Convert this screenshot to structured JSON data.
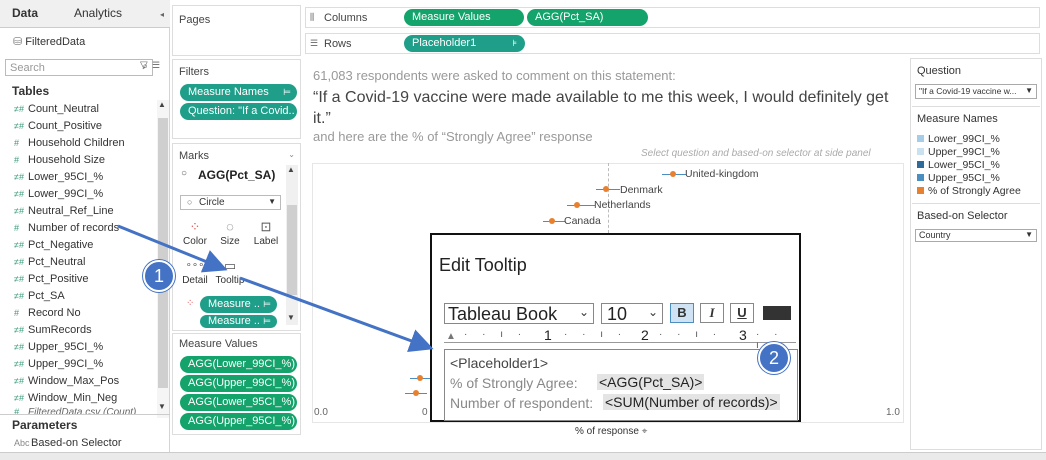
{
  "data_pane": {
    "tabs": [
      "Data",
      "Analytics"
    ],
    "datasource": "FilteredData",
    "search_placeholder": "Search",
    "tables_heading": "Tables",
    "fields": [
      "Count_Neutral",
      "Count_Positive",
      "Household Children",
      "Household Size",
      "Lower_95CI_%",
      "Lower_99CI_%",
      "Neutral_Ref_Line",
      "Number of records",
      "Pct_Negative",
      "Pct_Neutral",
      "Pct_Positive",
      "Pct_SA",
      "Record No",
      "SumRecords",
      "Upper_95CI_%",
      "Upper_99CI_%",
      "Window_Max_Pos",
      "Window_Min_Neg",
      "FilteredData.csv (Count)"
    ],
    "parameters_heading": "Parameters",
    "parameters": [
      "Based-on Selector"
    ]
  },
  "pages": {
    "label": "Pages"
  },
  "filters": {
    "label": "Filters",
    "pills": [
      "Measure Names",
      "Question: \"If a Covid.."
    ]
  },
  "marks": {
    "label": "Marks",
    "card_title": "AGG(Pct_SA)",
    "mark_type": "Circle",
    "buttons": [
      "Color",
      "Size",
      "Label",
      "Detail",
      "Tooltip"
    ],
    "pills": [
      "Measure ..",
      "Measure .."
    ]
  },
  "measure_values": {
    "label": "Measure Values",
    "pills": [
      "AGG(Lower_99CI_%)",
      "AGG(Upper_99CI_%)",
      "AGG(Lower_95CI_%)",
      "AGG(Upper_95CI_%)"
    ]
  },
  "shelves": {
    "columns_label": "Columns",
    "columns": [
      "Measure Values",
      "AGG(Pct_SA)"
    ],
    "rows_label": "Rows",
    "rows": [
      "Placeholder1"
    ]
  },
  "view": {
    "subtitle": "61,083 respondents were asked to comment on this statement:",
    "quote": "“If a Covid-19 vaccine were made available to me this week, I would definitely get it.”",
    "note": "and here are the % of “Strongly Agree” response",
    "hint": "Select question and based-on selector at side panel",
    "countries": [
      "United-kingdom",
      "Denmark",
      "Netherlands",
      "Canada"
    ],
    "axis_min": "0.0",
    "axis_zero": "0",
    "axis_max": "1.0",
    "axis_title": "% of response"
  },
  "tooltip_dialog": {
    "title": "Edit Tooltip",
    "font": "Tableau Book",
    "size": "10",
    "bold": "B",
    "italic": "I",
    "underline": "U",
    "ruler": [
      "1",
      "2",
      "3"
    ],
    "line1": "<Placeholder1>",
    "line2_label": "% of Strongly Agree:",
    "line2_value": "<AGG(Pct_SA)>",
    "line3_label": "Number of respondent:",
    "line3_value": "<SUM(Number of records)>"
  },
  "right_panel": {
    "question_label": "Question",
    "question_value": "\"If a Covid-19 vaccine w...",
    "measure_names_label": "Measure Names",
    "legend": [
      {
        "label": "Lower_99CI_%",
        "color": "#a6cde8"
      },
      {
        "label": "Upper_99CI_%",
        "color": "#c9e1f0"
      },
      {
        "label": "Lower_95CI_%",
        "color": "#2f6b9a"
      },
      {
        "label": "Upper_95CI_%",
        "color": "#4a8fbf"
      },
      {
        "label": "% of Strongly Agree",
        "color": "#e8812f"
      }
    ],
    "selector_label": "Based-on Selector",
    "selector_value": "Country"
  },
  "callouts": [
    "1",
    "2"
  ],
  "colors": {
    "pill_teal": "#1f9e89",
    "pill_green": "#14a36b",
    "callout": "#4472c4",
    "point": "#e8812f",
    "ci_line": "#4a8fbf"
  }
}
